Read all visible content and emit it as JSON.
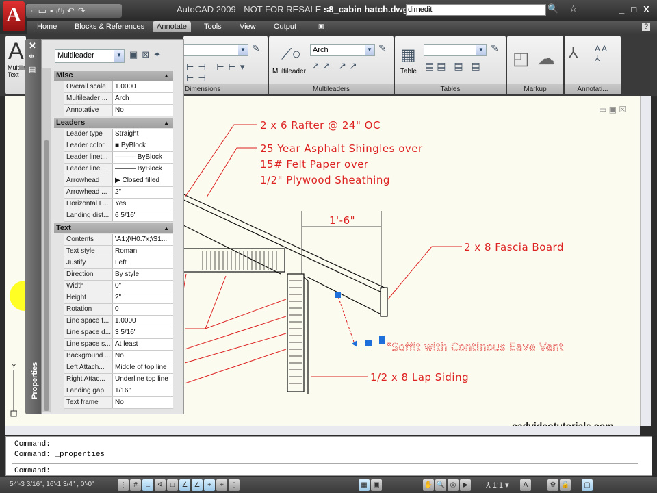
{
  "titlebar": {
    "app": "AutoCAD 2009 - NOT FOR RESALE",
    "file": "s8_cabin hatch.dwg",
    "search_value": "dimedit",
    "logo": "A"
  },
  "tabs": [
    "Home",
    "Blocks & References",
    "Annotate",
    "Tools",
    "View",
    "Output"
  ],
  "active_tab": "Annotate",
  "ribbon": {
    "text_panel_label": "Multiline Text",
    "dimensions_panel": "Dimensions",
    "multileaders_panel": "Multileaders",
    "multileader_button": "Multileader",
    "multileader_style": "Arch",
    "tables_panel": "Tables",
    "table_button": "Table",
    "markup_panel": "Markup",
    "annotation_panel": "Annotati..."
  },
  "properties": {
    "title": "Properties",
    "object_type": "Multileader",
    "sections": [
      {
        "name": "Misc",
        "rows": [
          [
            "Overall scale",
            "1.0000"
          ],
          [
            "Multileader ...",
            "Arch"
          ],
          [
            "Annotative",
            "No"
          ]
        ]
      },
      {
        "name": "Leaders",
        "rows": [
          [
            "Leader type",
            "Straight"
          ],
          [
            "Leader color",
            "■ ByBlock"
          ],
          [
            "Leader linet...",
            "——— ByBlock"
          ],
          [
            "Leader line...",
            "——— ByBlock"
          ],
          [
            "Arrowhead",
            "▶ Closed filled"
          ],
          [
            "Arrowhead ...",
            "2\""
          ],
          [
            "Horizontal L...",
            "Yes"
          ],
          [
            "Landing dist...",
            "6 5/16\""
          ]
        ]
      },
      {
        "name": "Text",
        "rows": [
          [
            "Contents",
            "\\A1;{\\H0.7x;\\S1..."
          ],
          [
            "Text style",
            "Roman"
          ],
          [
            "Justify",
            "Left"
          ],
          [
            "Direction",
            "By style"
          ],
          [
            "Width",
            "0\""
          ],
          [
            "Height",
            "2\""
          ],
          [
            "Rotation",
            "0"
          ],
          [
            "Line space f...",
            "1.0000"
          ],
          [
            "Line space d...",
            "3 5/16\""
          ],
          [
            "Line space s...",
            "At least"
          ],
          [
            "Background ...",
            "No"
          ],
          [
            "Left Attach...",
            "Middle of top line"
          ],
          [
            "Right Attac...",
            "Underline top line"
          ],
          [
            "Landing gap",
            "1/16\""
          ],
          [
            "Text frame",
            "No"
          ]
        ]
      }
    ]
  },
  "drawing": {
    "labels": {
      "rafter": "2 x 6 Rafter @ 24\" OC",
      "shingles_1": "25 Year Asphalt Shingles over",
      "shingles_2": "15# Felt Paper over",
      "shingles_3": "1/2\" Plywood Sheathing",
      "dimension": "1'-6\"",
      "fascia": "2 x 8 Fascia Board",
      "soffit": "\"Soffit with Continous Eave Vent",
      "siding": "1/2 x 8 Lap Siding"
    },
    "watermark": "cadvideotutorials.com",
    "ucs_y": "Y",
    "colors": {
      "annotation": "#dd2222",
      "background": "#fcfbef",
      "grip": "#1e6fd9"
    }
  },
  "command": {
    "lines": [
      "Command:",
      "Command: _properties"
    ],
    "prompt": "Command:"
  },
  "status": {
    "coords": "54'-3 3/16\", 16'-1 3/4\" , 0'-0\"",
    "annotation_scale": "1:1"
  }
}
